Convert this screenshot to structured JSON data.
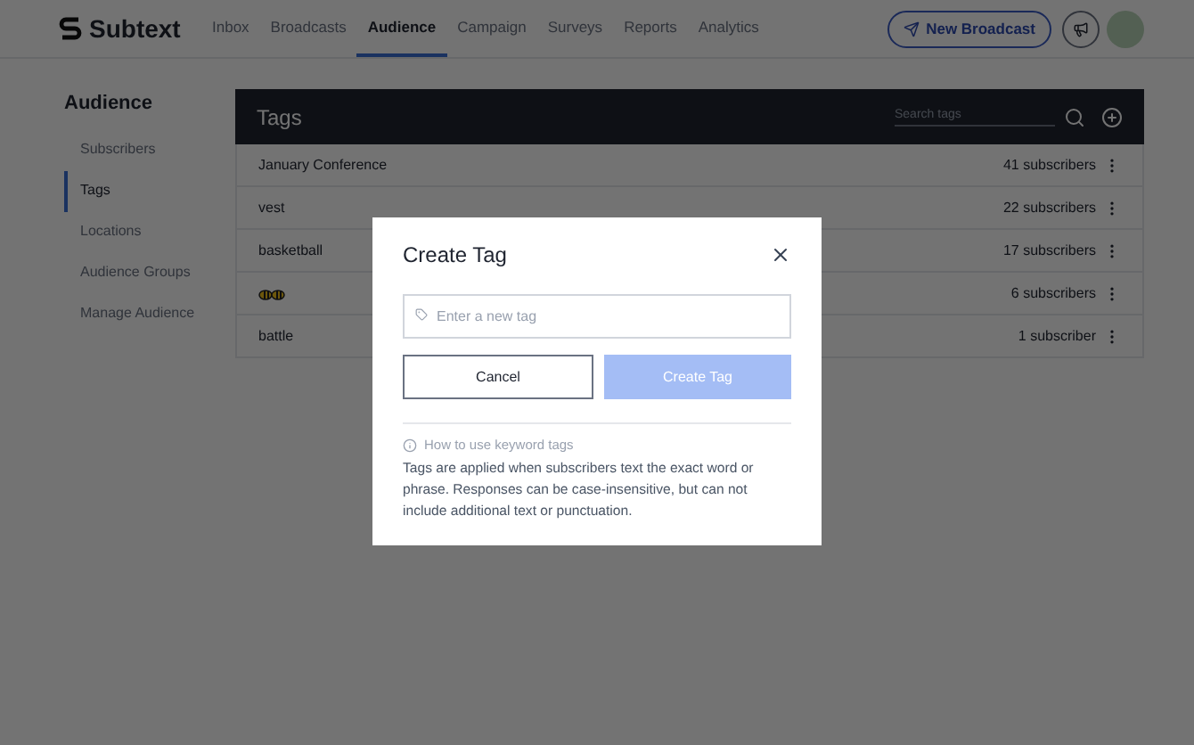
{
  "brand": {
    "name": "Subtext"
  },
  "nav": [
    {
      "label": "Inbox",
      "selected": false
    },
    {
      "label": "Broadcasts",
      "selected": false
    },
    {
      "label": "Audience",
      "selected": true
    },
    {
      "label": "Campaign",
      "selected": false
    },
    {
      "label": "Surveys",
      "selected": false
    },
    {
      "label": "Reports",
      "selected": false
    },
    {
      "label": "Analytics",
      "selected": false
    }
  ],
  "new_broadcast_button": "New Broadcast",
  "sidebar": {
    "title": "Audience",
    "items": [
      {
        "label": "Subscribers",
        "selected": false
      },
      {
        "label": "Tags",
        "selected": true
      },
      {
        "label": "Locations",
        "selected": false
      },
      {
        "label": "Audience Groups",
        "selected": false
      },
      {
        "label": "Manage Audience",
        "selected": false
      }
    ]
  },
  "tags_panel": {
    "title": "Tags",
    "search": {
      "placeholder": "Search tags"
    },
    "rows": [
      {
        "kind": "text",
        "name": "January Conference",
        "count": "41 subscribers"
      },
      {
        "kind": "text",
        "name": "vest",
        "count": "22 subscribers"
      },
      {
        "kind": "text",
        "name": "basketball",
        "count": "17 subscribers"
      },
      {
        "kind": "emoji",
        "count": "6 subscribers"
      },
      {
        "kind": "text",
        "name": "battle",
        "count": "1 subscriber"
      }
    ]
  },
  "dialog": {
    "title": "Create Tag",
    "input": {
      "placeholder": "Enter a new tag"
    },
    "buttons": [
      {
        "label": "Cancel",
        "kind": "secondary",
        "disabled": false
      },
      {
        "label": "Create Tag",
        "kind": "primary",
        "disabled": true
      }
    ],
    "help_link": "How to use keyword tags",
    "help_text": "Tags are applied when subscribers text the exact word or phrase. Responses can be case-insensitive, but can not include additional text or punctuation."
  }
}
